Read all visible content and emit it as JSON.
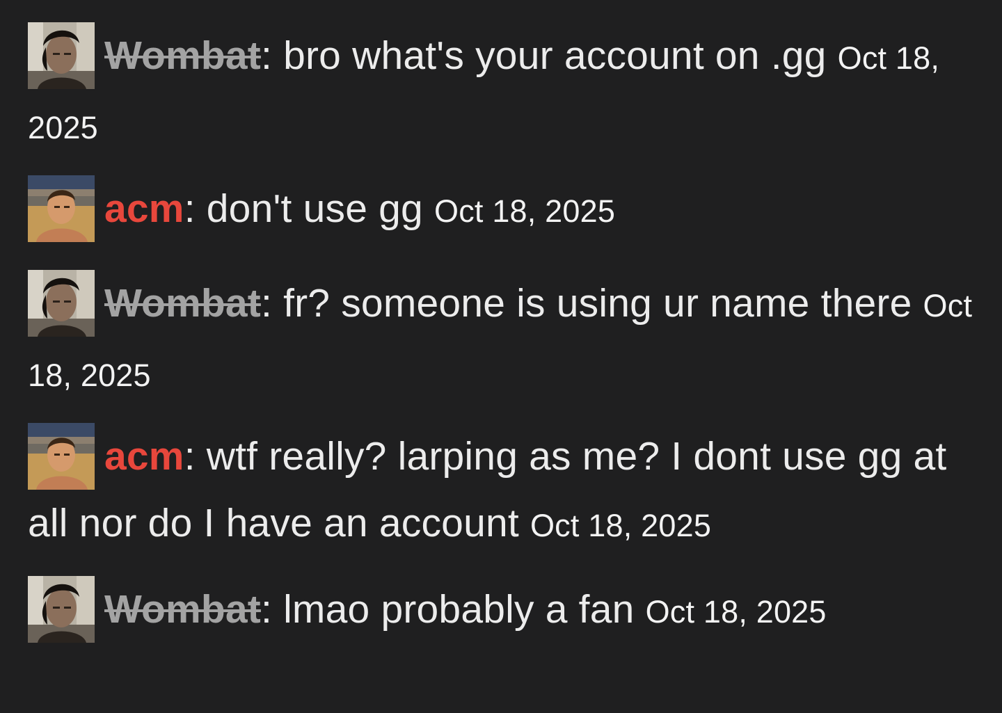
{
  "messages": [
    {
      "user": "Wombat",
      "user_style": "struck",
      "avatar": "portrait-dark-hair-avatar",
      "separator": ": ",
      "text": "bro what's your account on .gg",
      "timestamp": "Oct 18, 2025"
    },
    {
      "user": "acm",
      "user_style": "red",
      "avatar": "stadium-portrait-avatar",
      "separator": ": ",
      "text": "don't use gg",
      "timestamp": "Oct 18, 2025"
    },
    {
      "user": "Wombat",
      "user_style": "struck",
      "avatar": "portrait-dark-hair-avatar",
      "separator": ": ",
      "text": "fr? someone is using ur name there",
      "timestamp": "Oct 18, 2025"
    },
    {
      "user": "acm",
      "user_style": "red",
      "avatar": "stadium-portrait-avatar",
      "separator": ": ",
      "text": "wtf really? larping as me? I dont use gg at all nor do I have an account",
      "timestamp": "Oct 18, 2025"
    },
    {
      "user": "Wombat",
      "user_style": "struck",
      "avatar": "portrait-dark-hair-avatar",
      "separator": ": ",
      "text": "lmao probably a fan",
      "timestamp": "Oct 18, 2025"
    }
  ],
  "colors": {
    "background": "#1f1f20",
    "text": "#ececec",
    "struck_user": "#a3a3a3",
    "red_user": "#e8473c"
  }
}
